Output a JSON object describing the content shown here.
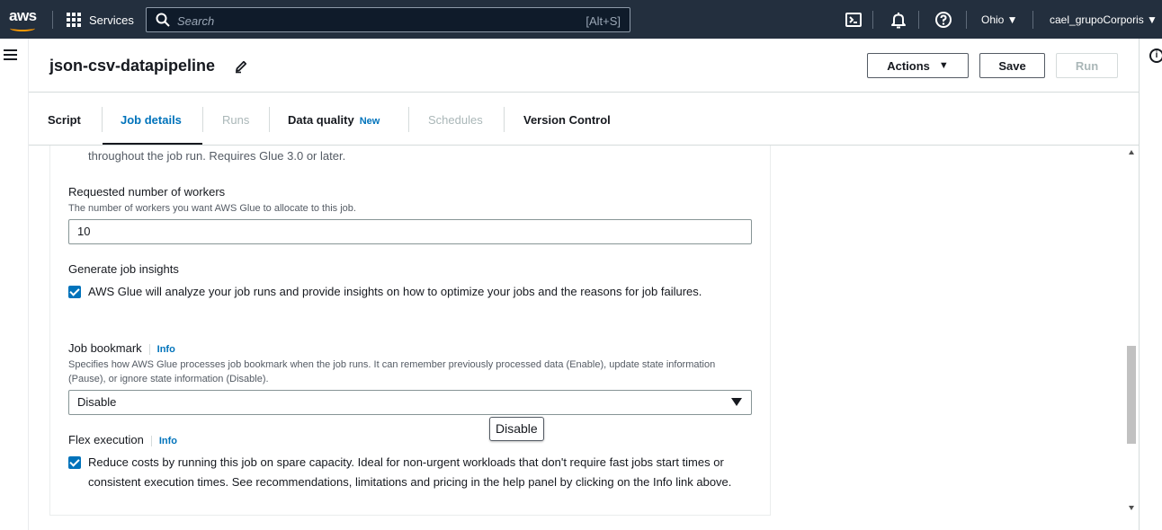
{
  "topnav": {
    "logo_text": "aws",
    "services_label": "Services",
    "search_placeholder": "Search",
    "search_shortcut": "[Alt+S]",
    "region": "Ohio ▼",
    "user": "cael_grupoCorporis ▼",
    "icons": [
      "cloudshell-icon",
      "bell-icon",
      "help-icon"
    ]
  },
  "header": {
    "title": "json-csv-datapipeline",
    "actions_label": "Actions",
    "save_label": "Save",
    "run_label": "Run"
  },
  "tabs": [
    {
      "label": "Script",
      "state": "normal"
    },
    {
      "label": "Job details",
      "state": "active"
    },
    {
      "label": "Runs",
      "state": "disabled"
    },
    {
      "label": "Data quality",
      "badge": "New",
      "state": "normal"
    },
    {
      "label": "Schedules",
      "state": "disabled"
    },
    {
      "label": "Version Control",
      "state": "normal"
    }
  ],
  "form": {
    "prev_desc_tail": "throughout the job run. Requires Glue 3.0 or later.",
    "workers": {
      "label": "Requested number of workers",
      "desc": "The number of workers you want AWS Glue to allocate to this job.",
      "value": "10"
    },
    "insights": {
      "label": "Generate job insights",
      "checked": true,
      "text": "AWS Glue will analyze your job runs and provide insights on how to optimize your jobs and the reasons for job failures."
    },
    "bookmark": {
      "label": "Job bookmark",
      "info": "Info",
      "desc": "Specifies how AWS Glue processes job bookmark when the job runs. It can remember previously processed data (Enable), update state information (Pause), or ignore state information (Disable).",
      "value": "Disable",
      "tooltip": "Disable"
    },
    "flex": {
      "label": "Flex execution",
      "info": "Info",
      "checked": true,
      "text": "Reduce costs by running this job on spare capacity. Ideal for non-urgent workloads that don't require fast jobs start times or consistent execution times. See recommendations, limitations and pricing in the help panel by clicking on the Info link above."
    }
  },
  "colors": {
    "nav_bg": "#232f3e",
    "accent": "#0073bb",
    "aws_orange": "#ff9900"
  }
}
